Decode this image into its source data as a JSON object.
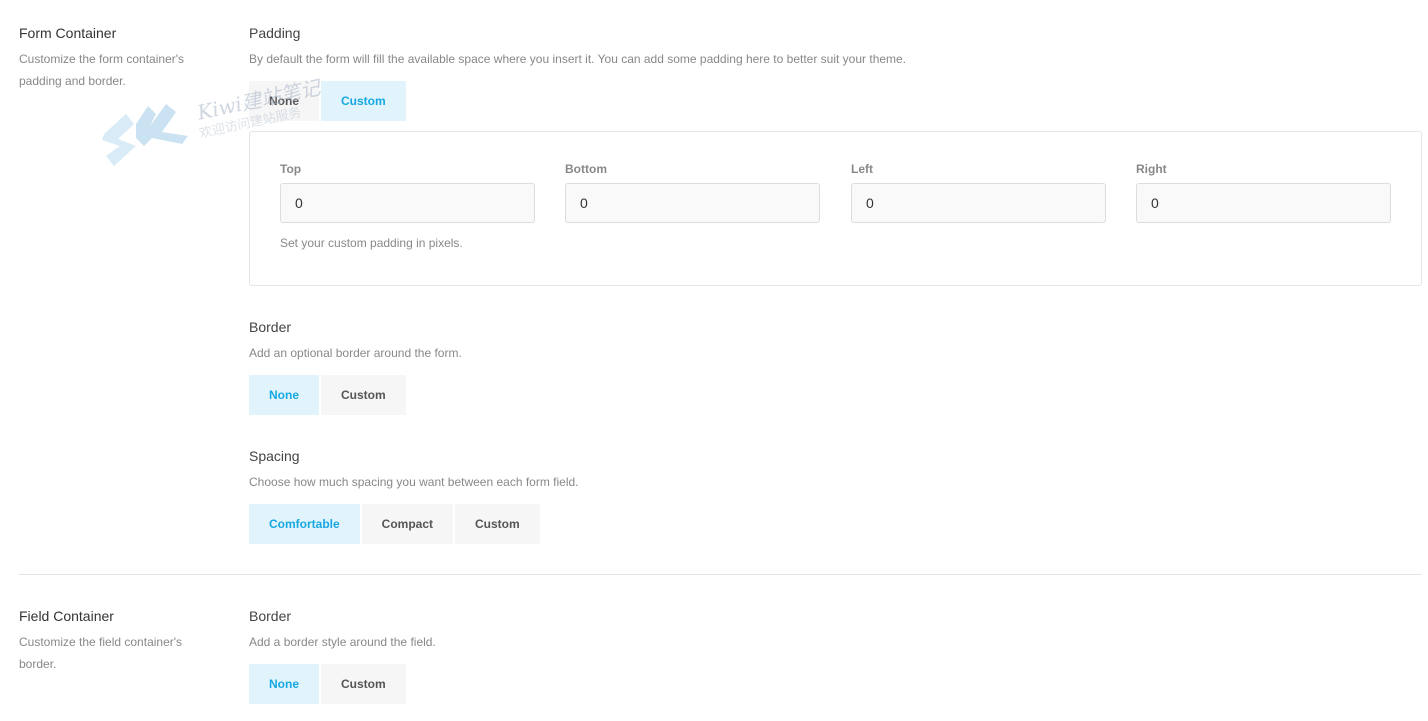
{
  "form_container": {
    "title": "Form Container",
    "description": "Customize the form container's padding and border.",
    "padding": {
      "title": "Padding",
      "description": "By default the form will fill the available space where you insert it. You can add some padding here to better suit your theme.",
      "options": [
        "None",
        "Custom"
      ],
      "selected": "Custom",
      "fields": {
        "top": {
          "label": "Top",
          "value": "0"
        },
        "bottom": {
          "label": "Bottom",
          "value": "0"
        },
        "left": {
          "label": "Left",
          "value": "0"
        },
        "right": {
          "label": "Right",
          "value": "0"
        }
      },
      "help": "Set your custom padding in pixels."
    },
    "border": {
      "title": "Border",
      "description": "Add an optional border around the form.",
      "options": [
        "None",
        "Custom"
      ],
      "selected": "None"
    },
    "spacing": {
      "title": "Spacing",
      "description": "Choose how much spacing you want between each form field.",
      "options": [
        "Comfortable",
        "Compact",
        "Custom"
      ],
      "selected": "Comfortable"
    }
  },
  "field_container": {
    "title": "Field Container",
    "description": "Customize the field container's border.",
    "border": {
      "title": "Border",
      "description": "Add a border style around the field.",
      "options": [
        "None",
        "Custom"
      ],
      "selected": "None"
    }
  },
  "watermark": {
    "text": "Kiwi建站笔记",
    "subtext": "欢迎访问建站服务"
  },
  "colors": {
    "accent": "#17a8e3",
    "active_bg": "#e1f4fb",
    "inactive_bg": "#f6f6f6"
  }
}
